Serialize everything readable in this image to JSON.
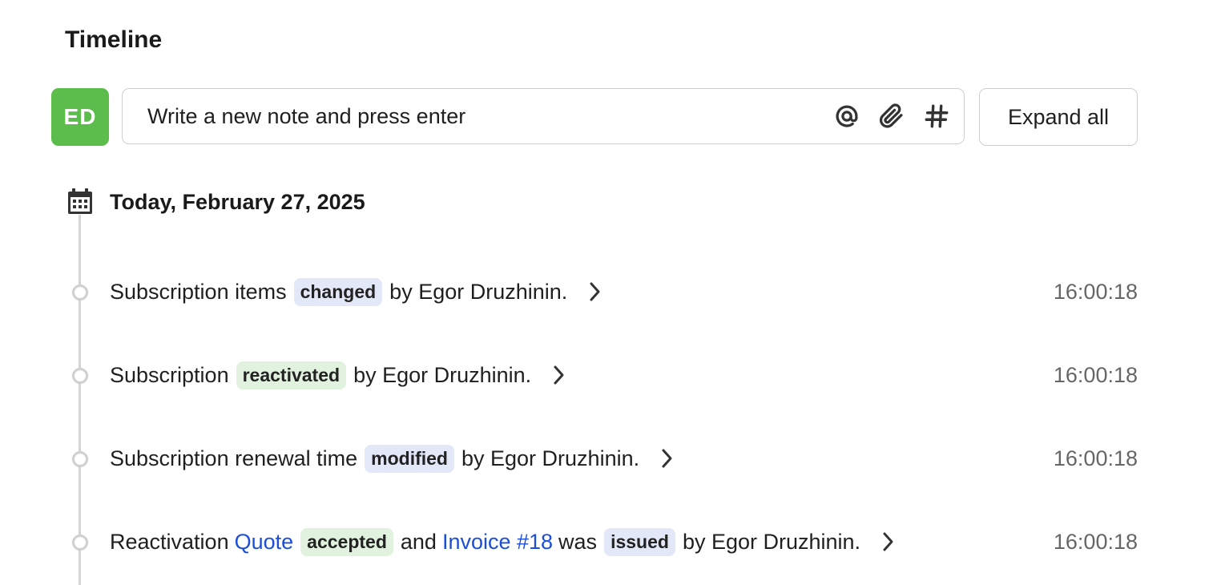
{
  "header": {
    "title": "Timeline"
  },
  "composer": {
    "avatar_initials": "ED",
    "avatar_color": "#5cbd4c",
    "placeholder": "Write a new note and press enter",
    "icons": [
      "at-icon",
      "paperclip-icon",
      "hashtag-icon"
    ],
    "expand_label": "Expand all"
  },
  "timeline": {
    "date_heading": "Today, February 27, 2025",
    "events": [
      {
        "t1": "Subscription items",
        "badge1": "changed",
        "t2": "by Egor Druzhinin.",
        "time": "16:00:18"
      },
      {
        "t1": "Subscription",
        "badge1": "reactivated",
        "t2": "by Egor Druzhinin.",
        "time": "16:00:18"
      },
      {
        "t1": "Subscription renewal time",
        "badge1": "modified",
        "t2": "by Egor Druzhinin.",
        "time": "16:00:18"
      },
      {
        "t1": "Reactivation",
        "link1": "Quote",
        "badge1": "accepted",
        "t2": "and",
        "link2": "Invoice #18",
        "t3": "was",
        "badge2": "issued",
        "t4": "by Egor Druzhinin.",
        "time": "16:00:18"
      }
    ]
  },
  "colors": {
    "badge_blue": "#e3e8f8",
    "badge_green": "#e1f3df",
    "link": "#1d4ed8",
    "timeline_line": "#d6d6d6"
  }
}
